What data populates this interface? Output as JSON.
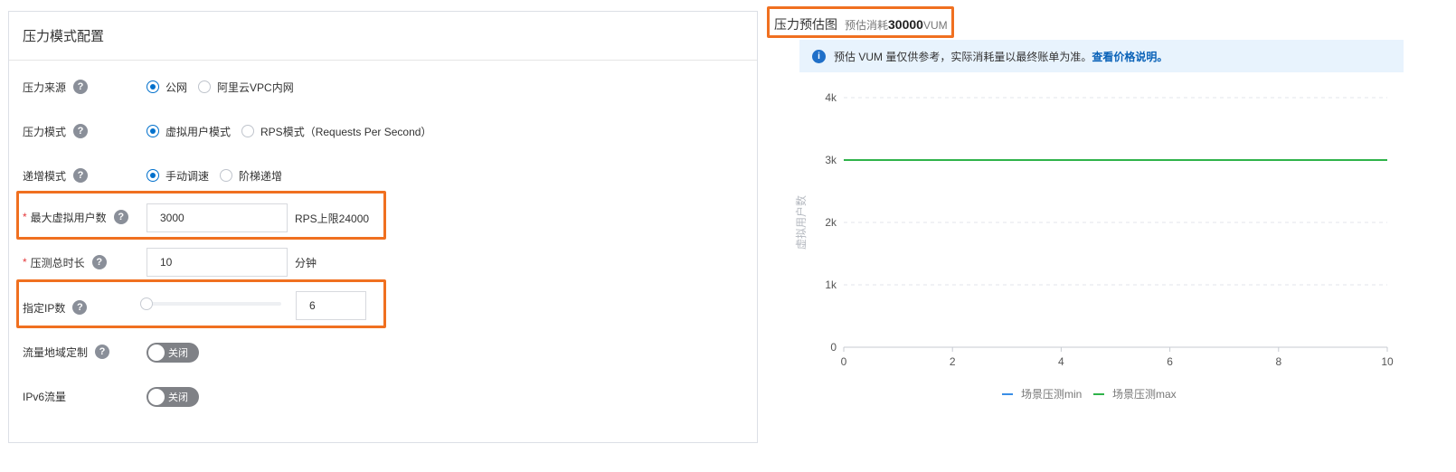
{
  "config": {
    "title": "压力模式配置",
    "pressure_source": {
      "label": "压力来源",
      "options": [
        "公网",
        "阿里云VPC内网"
      ],
      "selected": "公网"
    },
    "pressure_mode": {
      "label": "压力模式",
      "options": [
        "虚拟用户模式",
        "RPS模式（Requests Per Second）"
      ],
      "selected": "虚拟用户模式"
    },
    "increment_mode": {
      "label": "递增模式",
      "options": [
        "手动调速",
        "阶梯递增"
      ],
      "selected": "手动调速"
    },
    "max_virtual_users": {
      "required_mark": "*",
      "label": "最大虚拟用户数",
      "value": "3000",
      "suffix": "RPS上限24000"
    },
    "duration": {
      "required_mark": "*",
      "label": "压测总时长",
      "value": "10",
      "suffix": "分钟"
    },
    "ip_count": {
      "label": "指定IP数",
      "value": "6",
      "slider_fraction": 0.0
    },
    "region_custom": {
      "label": "流量地域定制",
      "switch_text": "关闭",
      "on": false
    },
    "ipv6": {
      "label": "IPv6流量",
      "switch_text": "关闭",
      "on": false
    },
    "help_glyph": "?"
  },
  "chart_panel": {
    "title": "压力预估图",
    "estimate_prefix": "预估消耗",
    "estimate_value": "30000",
    "estimate_unit": "VUM",
    "notice_text": "预估 VUM 量仅供参考，实际消耗量以最终账单为准。",
    "notice_link": "查看价格说明。",
    "info_glyph": "i"
  },
  "chart_data": {
    "type": "line",
    "ylabel": "虚拟用户数",
    "xlabel": "",
    "x": [
      0,
      10
    ],
    "xlim": [
      0,
      10
    ],
    "ylim": [
      0,
      4000
    ],
    "x_ticks": [
      0,
      2,
      4,
      6,
      8,
      10
    ],
    "y_ticks": [
      0,
      1000,
      2000,
      3000,
      4000
    ],
    "y_tick_labels": [
      "0",
      "1k",
      "2k",
      "3k",
      "4k"
    ],
    "grid": true,
    "legend_position": "bottom-center",
    "series": [
      {
        "name": "场景压测min",
        "color": "#3a8ee6",
        "values": [
          3000,
          3000
        ]
      },
      {
        "name": "场景压测max",
        "color": "#2fb34a",
        "values": [
          3000,
          3000
        ]
      }
    ]
  },
  "colors": {
    "accent": "#0070cc",
    "highlight": "#f07020",
    "switch_off": "#7f8186"
  }
}
